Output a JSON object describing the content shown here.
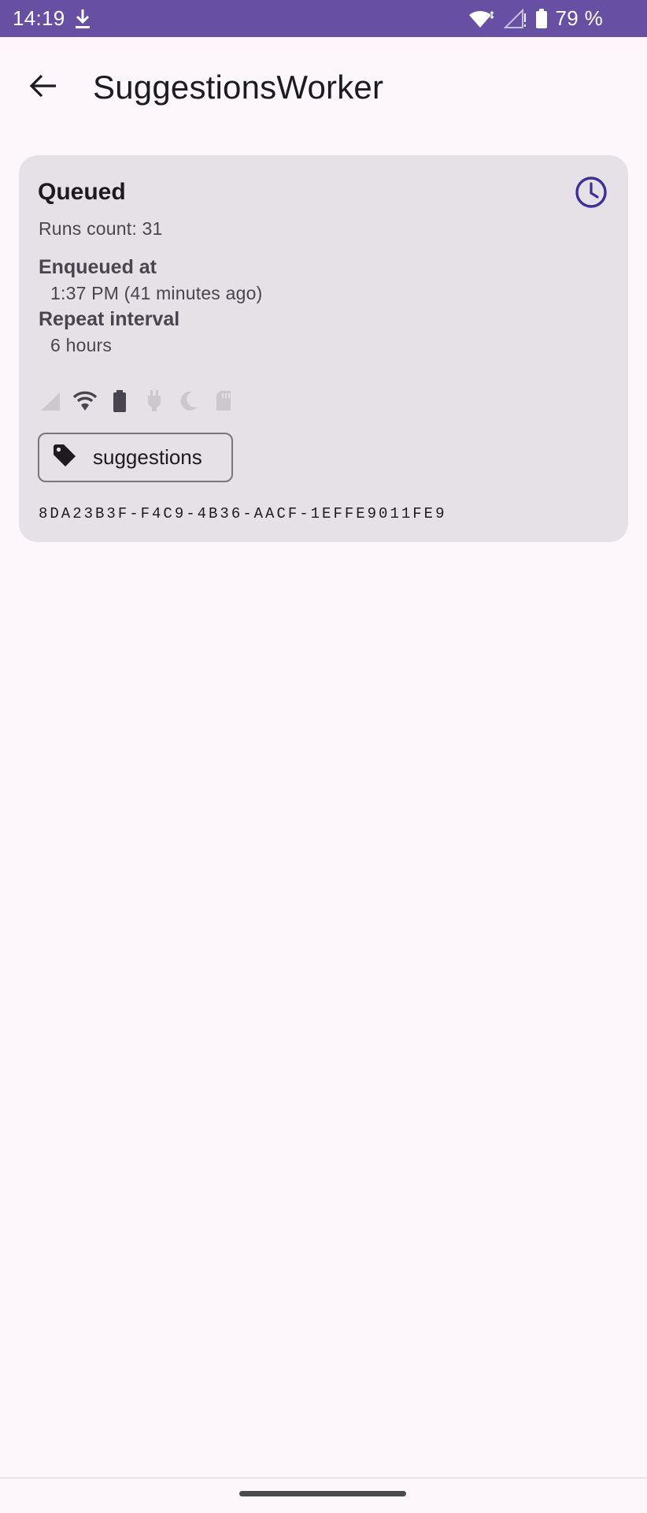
{
  "status_bar": {
    "time": "14:19",
    "battery_percent": "79 %",
    "icons": [
      "download-icon",
      "wifi-icon",
      "cellular-signal-icon",
      "battery-icon"
    ],
    "background": "#6750a4"
  },
  "app_bar": {
    "title": "SuggestionsWorker",
    "back_icon": "arrow-back-icon"
  },
  "work_card": {
    "state": "Queued",
    "state_icon": "clock-icon",
    "accent": "#3f2f9a",
    "runs_count": "Runs count: 31",
    "enqueued_label": "Enqueued at",
    "enqueued_value": "1:37 PM (41 minutes ago)",
    "repeat_label": "Repeat interval",
    "repeat_value": "6 hours",
    "constraints": [
      {
        "icon": "network-signal-icon",
        "active": false
      },
      {
        "icon": "wifi-icon",
        "active": true
      },
      {
        "icon": "battery-icon",
        "active": true
      },
      {
        "icon": "power-plug-icon",
        "active": false
      },
      {
        "icon": "moon-idle-icon",
        "active": false
      },
      {
        "icon": "storage-card-icon",
        "active": false
      }
    ],
    "tag": "suggestions",
    "tag_icon": "tag-icon",
    "id": "8DA23B3F-F4C9-4B36-AACF-1EFFE9011FE9"
  }
}
